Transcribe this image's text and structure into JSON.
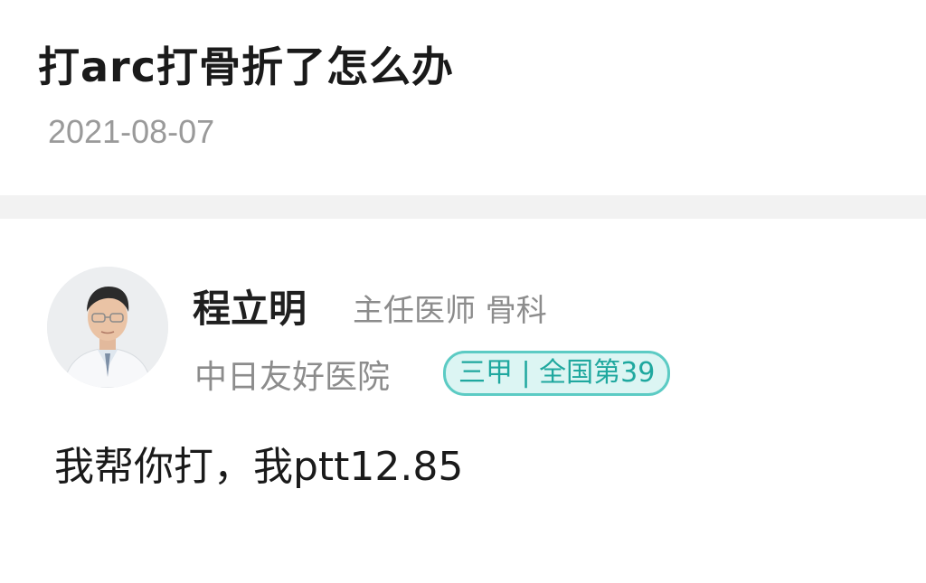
{
  "question": {
    "title": "打arc打骨折了怎么办",
    "date": "2021-08-07"
  },
  "answer": {
    "doctor": {
      "name": "程立明",
      "title": "主任医师  骨科",
      "hospital": "中日友好医院",
      "badge": "三甲 | 全国第39",
      "avatar_icon": "doctor-portrait"
    },
    "text": "我帮你打，我ptt12.85"
  },
  "colors": {
    "badge_border": "#5ccbc4",
    "badge_bg": "#dcf5f3",
    "badge_text": "#1fa89f",
    "divider": "#f2f2f2"
  }
}
